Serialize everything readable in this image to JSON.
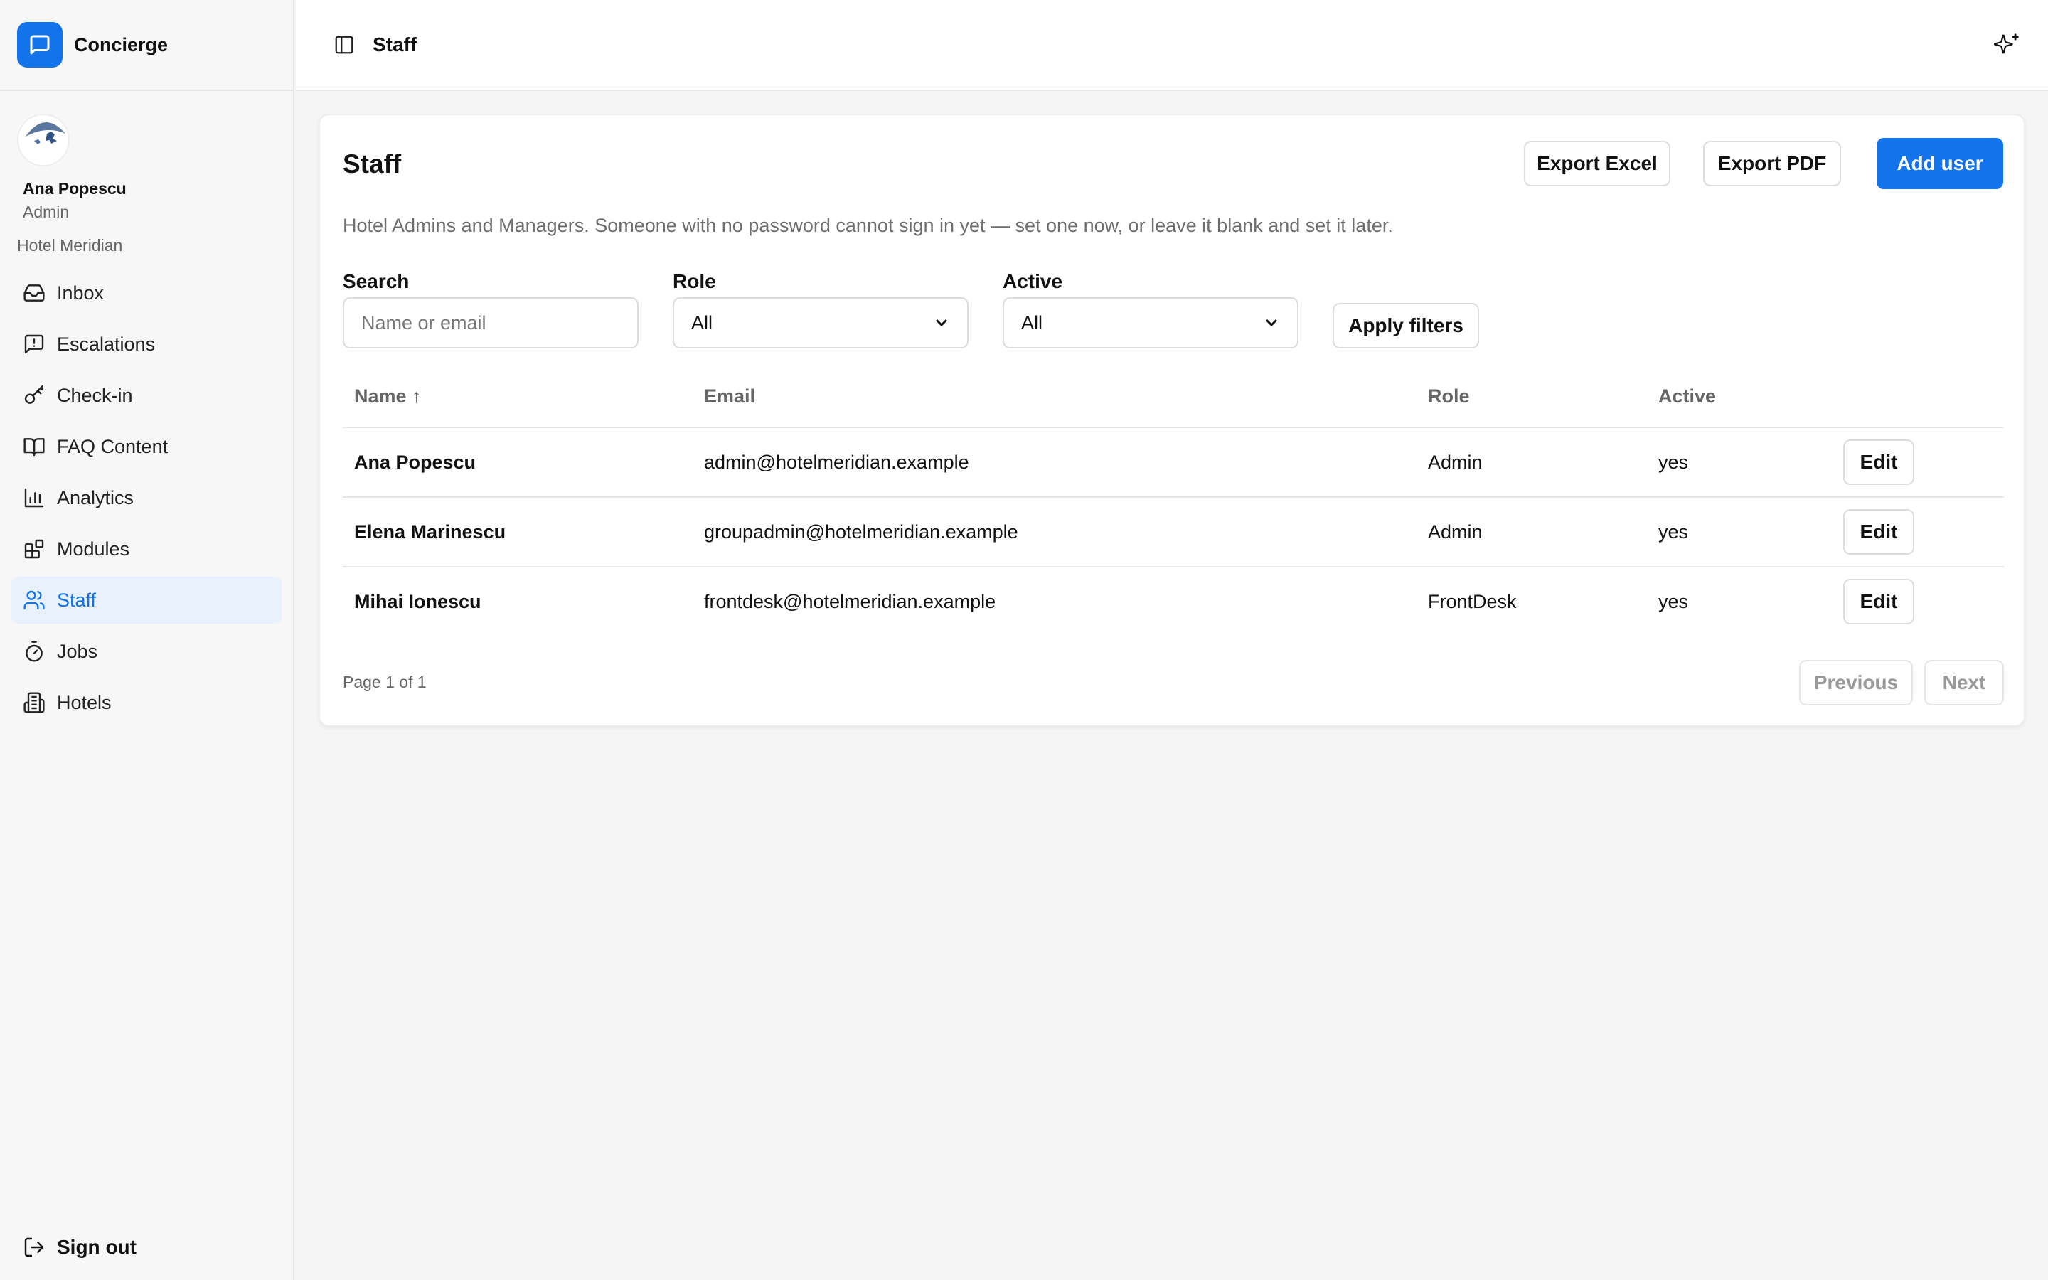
{
  "app": {
    "name": "Concierge"
  },
  "user": {
    "name": "Ana Popescu",
    "role": "Admin",
    "hotel": "Hotel Meridian"
  },
  "sidebar": {
    "items": [
      {
        "label": "Inbox",
        "icon": "inbox-icon"
      },
      {
        "label": "Escalations",
        "icon": "message-alert-icon"
      },
      {
        "label": "Check-in",
        "icon": "key-icon"
      },
      {
        "label": "FAQ Content",
        "icon": "book-icon"
      },
      {
        "label": "Analytics",
        "icon": "bar-chart-icon"
      },
      {
        "label": "Modules",
        "icon": "blocks-icon"
      },
      {
        "label": "Staff",
        "icon": "users-icon",
        "active": true
      },
      {
        "label": "Jobs",
        "icon": "timer-icon"
      },
      {
        "label": "Hotels",
        "icon": "building-icon"
      }
    ],
    "sign_out": "Sign out"
  },
  "topbar": {
    "title": "Staff"
  },
  "page": {
    "title": "Staff",
    "description": "Hotel Admins and Managers. Someone with no password cannot sign in yet — set one now, or leave it blank and set it later.",
    "actions": {
      "export_excel": "Export Excel",
      "export_pdf": "Export PDF",
      "add_user": "Add user"
    }
  },
  "filters": {
    "search_label": "Search",
    "search_placeholder": "Name or email",
    "search_value": "",
    "role_label": "Role",
    "role_value": "All",
    "active_label": "Active",
    "active_value": "All",
    "apply_label": "Apply filters"
  },
  "table": {
    "columns": [
      "Name ↑",
      "Email",
      "Role",
      "Active"
    ],
    "rows": [
      {
        "name": "Ana Popescu",
        "email": "admin@hotelmeridian.example",
        "role": "Admin",
        "active": "yes",
        "action": "Edit"
      },
      {
        "name": "Elena Marinescu",
        "email": "groupadmin@hotelmeridian.example",
        "role": "Admin",
        "active": "yes",
        "action": "Edit"
      },
      {
        "name": "Mihai Ionescu",
        "email": "frontdesk@hotelmeridian.example",
        "role": "FrontDesk",
        "active": "yes",
        "action": "Edit"
      }
    ]
  },
  "pagination": {
    "text": "Page 1 of 1",
    "previous": "Previous",
    "next": "Next"
  },
  "colors": {
    "accent": "#1273eb",
    "active_nav_bg": "#e8f1fc",
    "sidebar_bg": "#f7f7f7",
    "page_bg": "#f5f5f5"
  }
}
